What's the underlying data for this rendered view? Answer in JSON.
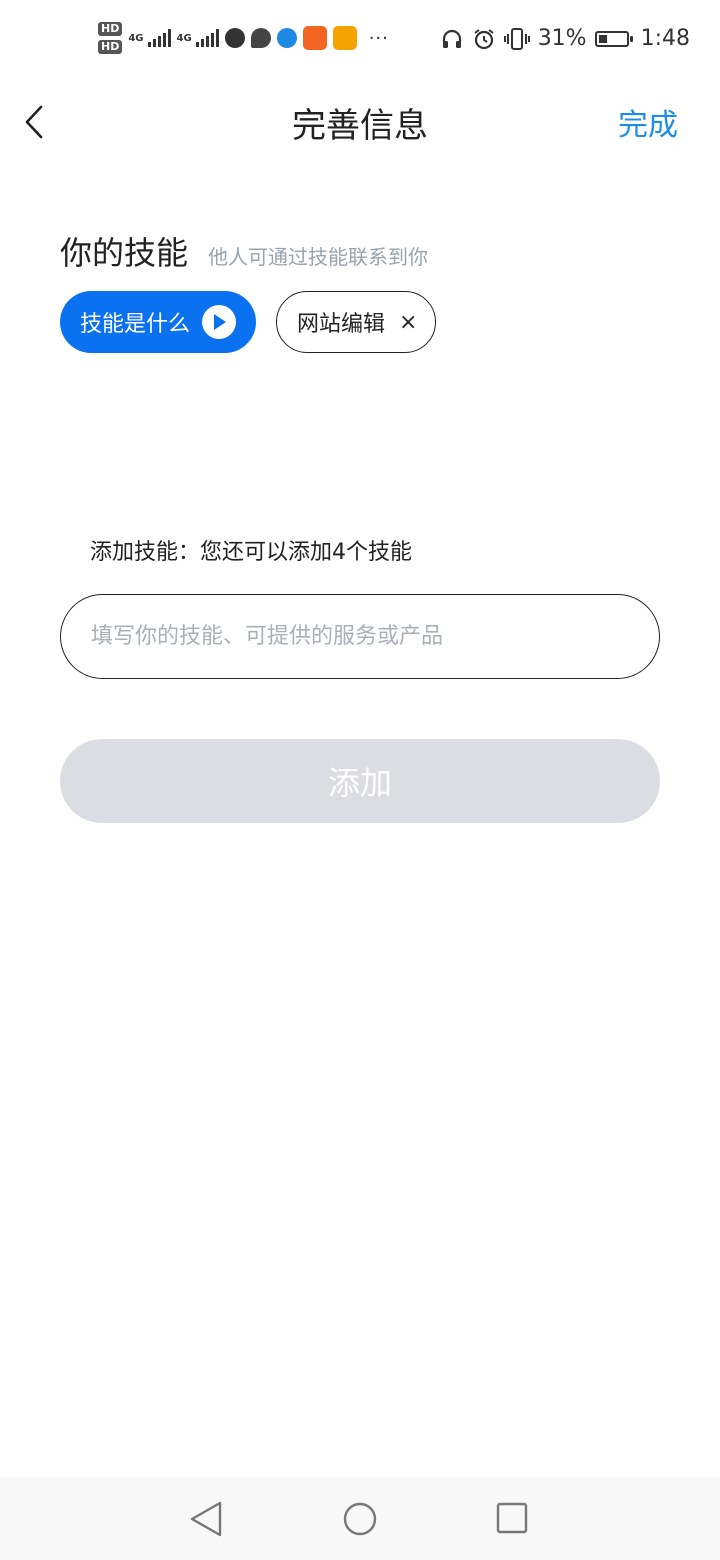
{
  "status_bar": {
    "sim1": "HD",
    "sim2": "HD",
    "net1": "4G",
    "net2": "4G",
    "battery_percent": "31%",
    "battery_level": 0.31,
    "time": "1:48",
    "more": "···"
  },
  "header": {
    "title": "完善信息",
    "done_label": "完成"
  },
  "skills": {
    "title": "你的技能",
    "subtitle": "他人可通过技能联系到你",
    "help_tag": "技能是什么",
    "tags": [
      "网站编辑"
    ],
    "remove_symbol": "×"
  },
  "add_section": {
    "hint": "添加技能：您还可以添加4个技能",
    "input_placeholder": "填写你的技能、可提供的服务或产品",
    "input_value": "",
    "add_button": "添加"
  },
  "colors": {
    "accent": "#0a72f0",
    "link": "#1c8de8",
    "disabled_button": "#dcdde2"
  }
}
